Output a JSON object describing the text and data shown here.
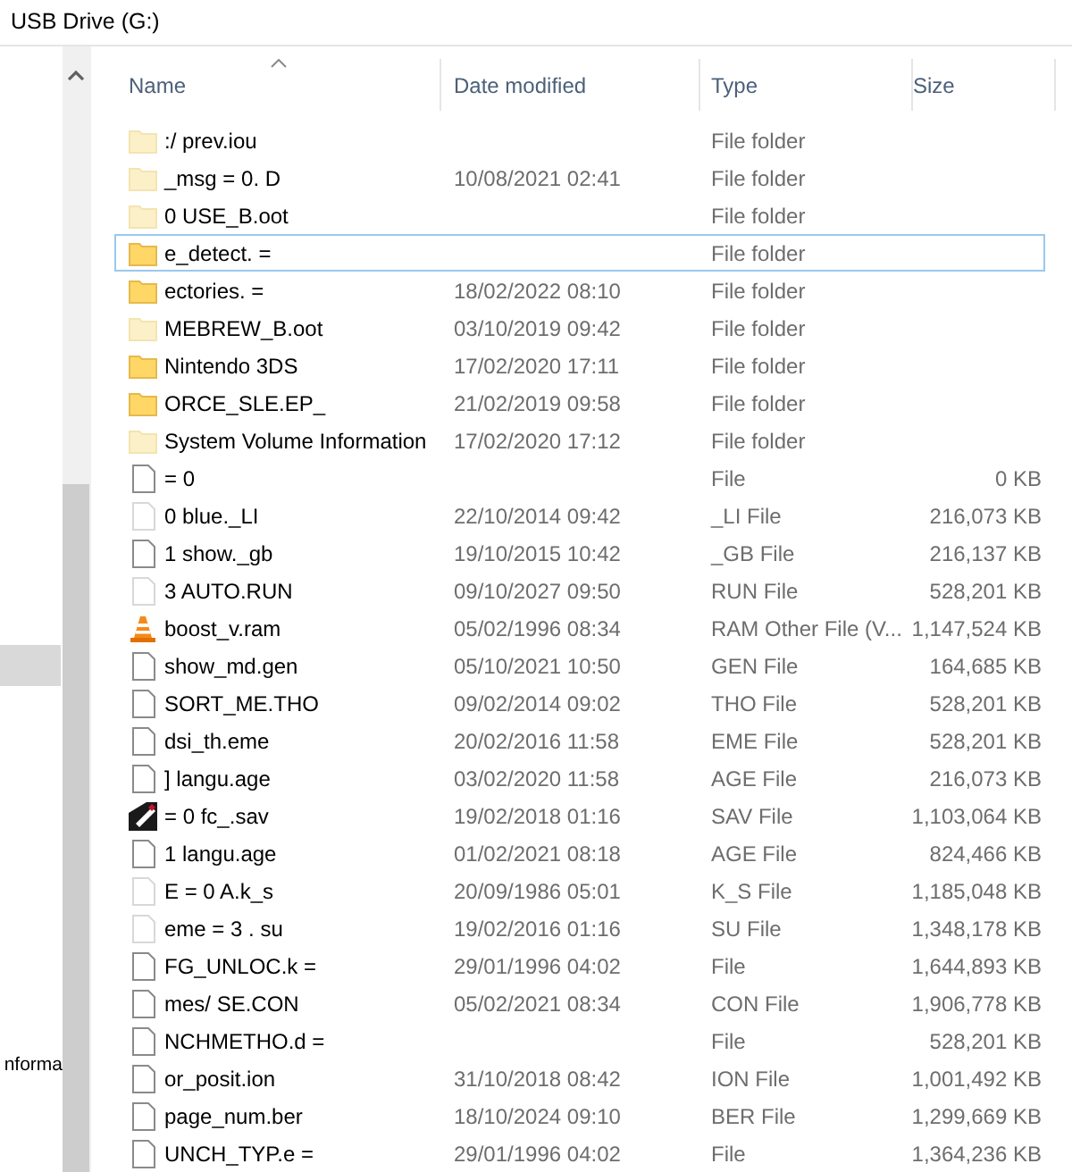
{
  "window": {
    "title": "USB Drive (G:)"
  },
  "sidebar": {
    "items": [
      {
        "label": "nforma"
      }
    ]
  },
  "table": {
    "columns": [
      {
        "label": "Name",
        "sorted": true
      },
      {
        "label": "Date modified",
        "sorted": false
      },
      {
        "label": "Type",
        "sorted": false
      },
      {
        "label": "Size",
        "sorted": false
      }
    ],
    "rows": [
      {
        "kind": "folder",
        "hidden": true,
        "focused": false,
        "name": ":/ prev.iou",
        "date": "",
        "type": "File folder",
        "size": ""
      },
      {
        "kind": "folder",
        "hidden": true,
        "focused": false,
        "name": "_msg = 0. D",
        "date": "10/08/2021 02:41",
        "type": "File folder",
        "size": ""
      },
      {
        "kind": "folder",
        "hidden": true,
        "focused": false,
        "name": "0 USE_B.oot",
        "date": "",
        "type": "File folder",
        "size": ""
      },
      {
        "kind": "folder",
        "hidden": false,
        "focused": true,
        "name": "e_detect. =",
        "date": "",
        "type": "File folder",
        "size": ""
      },
      {
        "kind": "folder",
        "hidden": false,
        "focused": false,
        "name": "ectories. =",
        "date": "18/02/2022 08:10",
        "type": "File folder",
        "size": ""
      },
      {
        "kind": "folder",
        "hidden": true,
        "focused": false,
        "name": "MEBREW_B.oot",
        "date": "03/10/2019 09:42",
        "type": "File folder",
        "size": ""
      },
      {
        "kind": "folder",
        "hidden": false,
        "focused": false,
        "name": "Nintendo 3DS",
        "date": "17/02/2020 17:11",
        "type": "File folder",
        "size": ""
      },
      {
        "kind": "folder",
        "hidden": false,
        "focused": false,
        "name": "ORCE_SLE.EP_",
        "date": "21/02/2019 09:58",
        "type": "File folder",
        "size": ""
      },
      {
        "kind": "folder",
        "hidden": true,
        "focused": false,
        "name": "System Volume Information",
        "date": "17/02/2020 17:12",
        "type": "File folder",
        "size": ""
      },
      {
        "kind": "file",
        "hidden": false,
        "focused": false,
        "name": "= 0",
        "date": "",
        "type": "File",
        "size": "0 KB"
      },
      {
        "kind": "file",
        "hidden": true,
        "focused": false,
        "name": "0 blue._LI",
        "date": "22/10/2014 09:42",
        "type": "_LI File",
        "size": "216,073 KB"
      },
      {
        "kind": "file",
        "hidden": false,
        "focused": false,
        "name": "1 show._gb",
        "date": "19/10/2015 10:42",
        "type": "_GB File",
        "size": "216,137 KB"
      },
      {
        "kind": "file",
        "hidden": true,
        "focused": false,
        "name": "3 AUTO.RUN",
        "date": "09/10/2027 09:50",
        "type": "RUN File",
        "size": "528,201 KB"
      },
      {
        "kind": "media",
        "hidden": false,
        "focused": false,
        "name": "boost_v.ram",
        "date": "05/02/1996 08:34",
        "type": "RAM Other File (V...",
        "size": "1,147,524 KB"
      },
      {
        "kind": "file",
        "hidden": false,
        "focused": false,
        "name": "show_md.gen",
        "date": "05/10/2021 10:50",
        "type": "GEN File",
        "size": "164,685 KB"
      },
      {
        "kind": "file",
        "hidden": false,
        "focused": false,
        "name": "SORT_ME.THO",
        "date": "09/02/2014 09:02",
        "type": "THO File",
        "size": "528,201 KB"
      },
      {
        "kind": "file",
        "hidden": false,
        "focused": false,
        "name": "dsi_th.eme",
        "date": "20/02/2016 11:58",
        "type": "EME File",
        "size": "528,201 KB"
      },
      {
        "kind": "file",
        "hidden": false,
        "focused": false,
        "name": "] langu.age",
        "date": "03/02/2020 11:58",
        "type": "AGE File",
        "size": "216,073 KB"
      },
      {
        "kind": "save",
        "hidden": false,
        "focused": false,
        "name": "= 0 fc_.sav",
        "date": "19/02/2018 01:16",
        "type": "SAV File",
        "size": "1,103,064 KB"
      },
      {
        "kind": "file",
        "hidden": false,
        "focused": false,
        "name": "1 langu.age",
        "date": "01/02/2021 08:18",
        "type": "AGE File",
        "size": "824,466 KB"
      },
      {
        "kind": "file",
        "hidden": true,
        "focused": false,
        "name": "E = 0 A.k_s",
        "date": "20/09/1986 05:01",
        "type": "K_S File",
        "size": "1,185,048 KB"
      },
      {
        "kind": "file",
        "hidden": true,
        "focused": false,
        "name": "eme = 3 . su",
        "date": "19/02/2016 01:16",
        "type": "SU File",
        "size": "1,348,178 KB"
      },
      {
        "kind": "file",
        "hidden": false,
        "focused": false,
        "name": "FG_UNLOC.k =",
        "date": "29/01/1996 04:02",
        "type": "File",
        "size": "1,644,893 KB"
      },
      {
        "kind": "file",
        "hidden": false,
        "focused": false,
        "name": "mes/ SE.CON",
        "date": "05/02/2021 08:34",
        "type": "CON File",
        "size": "1,906,778 KB"
      },
      {
        "kind": "file",
        "hidden": false,
        "focused": false,
        "name": "NCHMETHO.d =",
        "date": "",
        "type": "File",
        "size": "528,201 KB"
      },
      {
        "kind": "file",
        "hidden": false,
        "focused": false,
        "name": "or_posit.ion",
        "date": "31/10/2018 08:42",
        "type": "ION File",
        "size": "1,001,492 KB"
      },
      {
        "kind": "file",
        "hidden": false,
        "focused": false,
        "name": "page_num.ber",
        "date": "18/10/2024 09:10",
        "type": "BER File",
        "size": "1,299,669 KB"
      },
      {
        "kind": "file",
        "hidden": false,
        "focused": false,
        "name": "UNCH_TYP.e =",
        "date": "29/01/1996 04:02",
        "type": "File",
        "size": "1,364,236 KB"
      }
    ]
  }
}
